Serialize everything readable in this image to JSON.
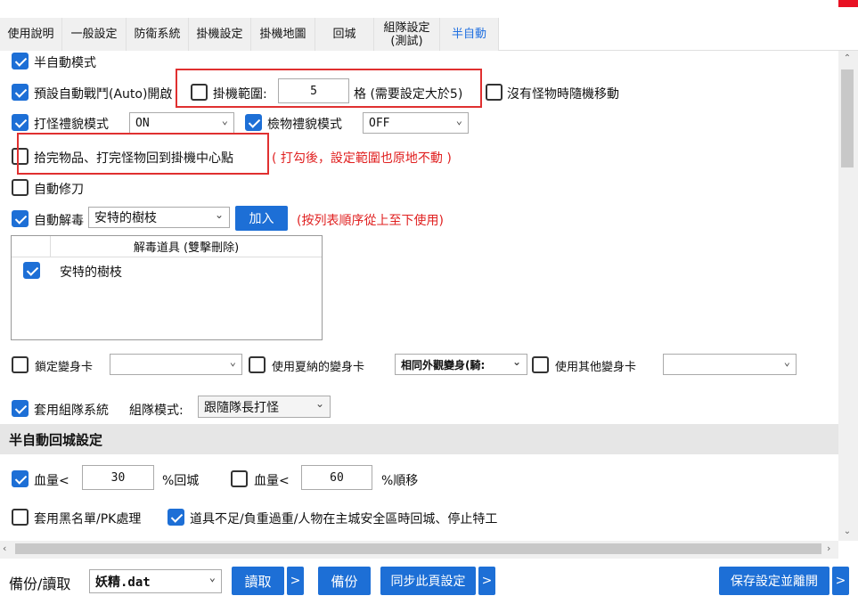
{
  "tabs": [
    "使用說明",
    "一般設定",
    "防衛系統",
    "掛機設定",
    "掛機地圖",
    "回城",
    "組隊設定\n(測試)",
    "半自動"
  ],
  "options": {
    "semi_auto_mode": "半自動模式",
    "auto_battle": "預設自動戰鬥(Auto)開啟",
    "range_label": "掛機範圍:",
    "range_value": "5",
    "range_hint": "格 (需要設定大於5)",
    "random_move": "沒有怪物時隨機移動",
    "combat_courtesy": "打怪禮貌模式",
    "combat_courtesy_value": "ON",
    "pickup_courtesy": "檢物禮貌模式",
    "pickup_courtesy_value": "OFF",
    "return_center": "拾完物品、打完怪物回到掛機中心點",
    "return_center_note": "( 打勾後，設定範圍也原地不動 )",
    "auto_repair": "自動修刀",
    "auto_detox": "自動解毒",
    "detox_item": "安特的樹枝",
    "add_button": "加入",
    "order_note": "(按列表順序從上至下使用)",
    "list_header": "解毒道具 (雙擊刪除)",
    "list_items": [
      "安特的樹枝"
    ],
    "lock_card": "鎖定變身卡",
    "use_summer_card": "使用夏納的變身卡",
    "summer_card_value": "相同外觀變身(騎:",
    "use_other_card": "使用其他變身卡",
    "party_system": "套用組隊系統",
    "party_mode_label": "組隊模式:",
    "party_mode_value": "跟隨隊長打怪"
  },
  "return_section": {
    "title": "半自動回城設定",
    "hp1_label": "血量<",
    "hp1_value": "30",
    "hp1_suffix": "%回城",
    "hp2_label": "血量<",
    "hp2_value": "60",
    "hp2_suffix": "%順移",
    "blacklist": "套用黑名單/PK處理",
    "shortage": "道具不足/負重過重/人物在主城安全區時回城、停止特工"
  },
  "footer": {
    "backup_label": "備份/讀取",
    "file_value": "妖精.dat",
    "read_button": "讀取",
    "backup_button": "備份",
    "sync_button": "同步此頁設定",
    "arrow": ">",
    "save_exit_button": "保存設定並離開"
  },
  "colors": {
    "accent": "#1d6fd6",
    "warning": "#e02020"
  }
}
